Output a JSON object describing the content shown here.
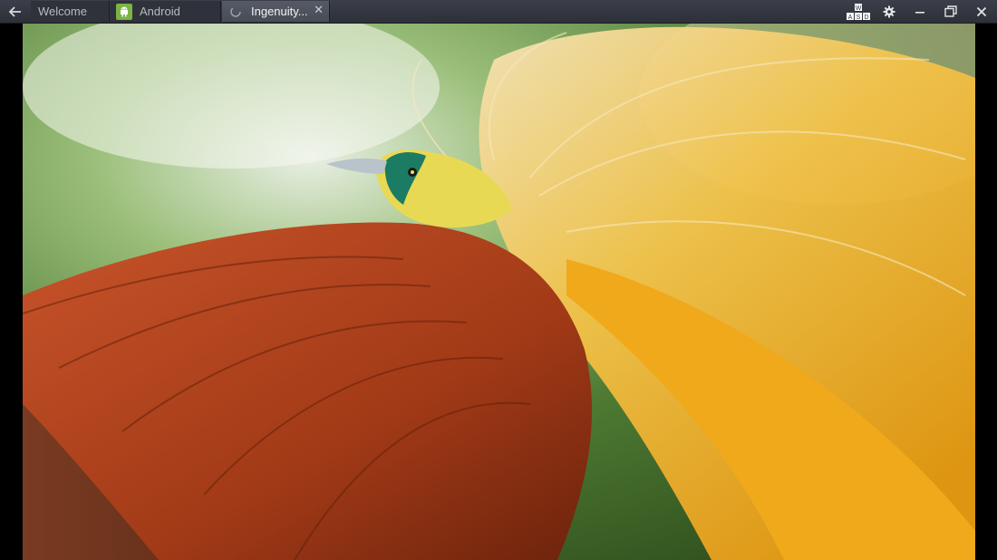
{
  "window": {
    "tabs": [
      {
        "label": "Welcome",
        "icon": "none",
        "active": false
      },
      {
        "label": "Android",
        "icon": "android-icon",
        "active": false
      },
      {
        "label": "Ingenuity...",
        "icon": "loading-icon",
        "active": true
      }
    ],
    "controls": [
      "keyboard-wasd-icon",
      "gear-icon",
      "minimize-icon",
      "restore-icon",
      "close-icon"
    ]
  },
  "colors": {
    "titlebar": "#2d3038",
    "active_tab": "#4d515c",
    "android_green": "#7cb342"
  }
}
